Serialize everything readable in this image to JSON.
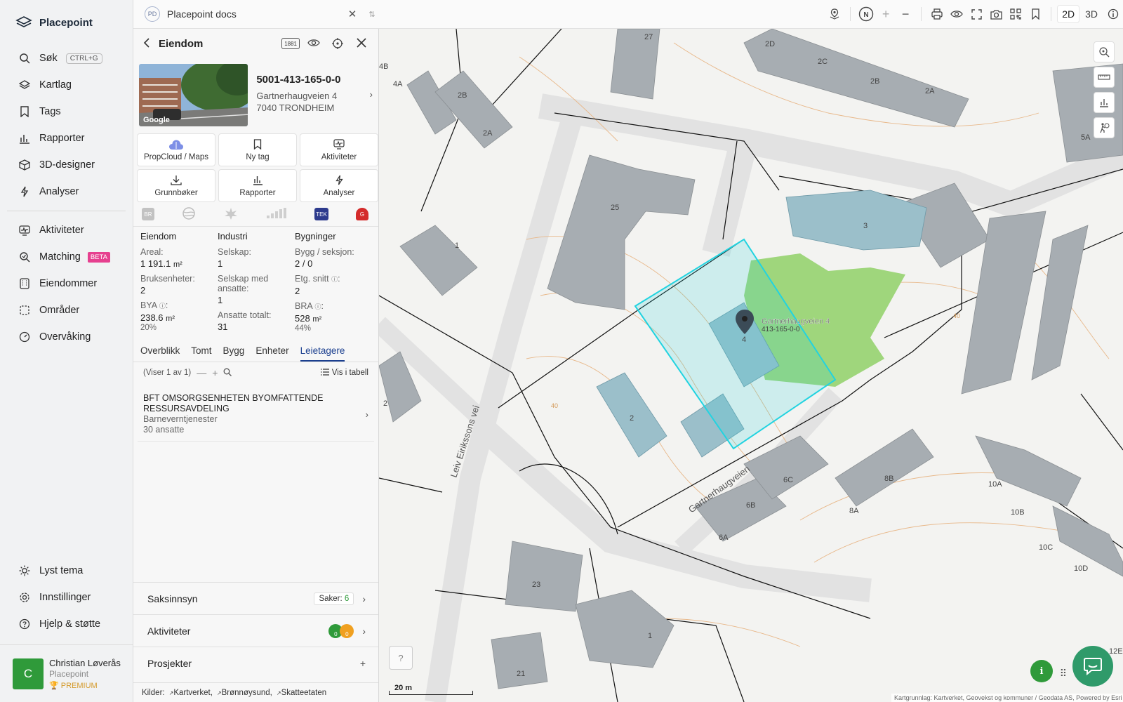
{
  "app": {
    "name": "Placepoint"
  },
  "nav": {
    "items": [
      {
        "label": "Søk",
        "icon": "search-icon",
        "shortcut": "CTRL+G"
      },
      {
        "label": "Kartlag",
        "icon": "layers-icon"
      },
      {
        "label": "Tags",
        "icon": "bookmark-icon"
      },
      {
        "label": "Rapporter",
        "icon": "bar-chart-icon"
      },
      {
        "label": "3D-designer",
        "icon": "cube-icon"
      },
      {
        "label": "Analyser",
        "icon": "bolt-icon"
      }
    ],
    "items2": [
      {
        "label": "Aktiviteter",
        "icon": "activity-icon"
      },
      {
        "label": "Matching",
        "icon": "match-icon",
        "badge": "BETA"
      },
      {
        "label": "Eiendommer",
        "icon": "building-icon"
      },
      {
        "label": "Områder",
        "icon": "area-icon"
      },
      {
        "label": "Overvåking",
        "icon": "monitor-icon"
      }
    ],
    "bottom": [
      {
        "label": "Lyst tema",
        "icon": "sun-icon"
      },
      {
        "label": "Innstillinger",
        "icon": "gear-icon"
      },
      {
        "label": "Hjelp & støtte",
        "icon": "help-icon"
      }
    ],
    "user": {
      "initial": "C",
      "name": "Christian Løverås",
      "org": "Placepoint",
      "plan": "PREMIUM"
    }
  },
  "topbar": {
    "doc_badge": "PD",
    "doc_title": "Placepoint docs",
    "mode_2d": "2D",
    "mode_3d": "3D",
    "north": "N"
  },
  "panel": {
    "title": "Eiendom",
    "badge_1881": "1881",
    "property": {
      "id": "5001-413-165-0-0",
      "address": "Gartnerhaugveien 4",
      "postal": "7040 TRONDHEIM",
      "thumb_label": "Google"
    },
    "actions": [
      {
        "label": "PropCloud / Maps",
        "icon": "cloud-icon"
      },
      {
        "label": "Ny tag",
        "icon": "bookmark-icon"
      },
      {
        "label": "Aktiviteter",
        "icon": "activity-icon"
      },
      {
        "label": "Grunnbøker",
        "icon": "download-icon"
      },
      {
        "label": "Rapporter",
        "icon": "bar-chart-icon"
      },
      {
        "label": "Analyser",
        "icon": "bolt-icon"
      }
    ],
    "logos": {
      "br": "BR",
      "tek": "TEK",
      "g": "G"
    },
    "stats": {
      "eiendom": {
        "header": "Eiendom",
        "areal_label": "Areal:",
        "areal_value": "1 191.1",
        "areal_unit": "m²",
        "bruk_label": "Bruksenheter:",
        "bruk_value": "2",
        "bya_label": "BYA",
        "bya_value": "238.6",
        "bya_unit": "m²",
        "bya_pct": "20%"
      },
      "industri": {
        "header": "Industri",
        "selskap_label": "Selskap:",
        "selskap_value": "1",
        "ansatte_label": "Selskap med ansatte:",
        "ansatte_value": "1",
        "total_label": "Ansatte totalt:",
        "total_value": "31"
      },
      "bygninger": {
        "header": "Bygninger",
        "bygg_label": "Bygg / seksjon:",
        "bygg_value": "2 / 0",
        "etg_label": "Etg. snitt",
        "etg_value": "2",
        "bra_label": "BRA",
        "bra_value": "528",
        "bra_unit": "m²",
        "bra_pct": "44%"
      }
    },
    "tabs": [
      "Overblikk",
      "Tomt",
      "Bygg",
      "Enheter",
      "Leietagere"
    ],
    "active_tab": "Leietagere",
    "list": {
      "count": "(Viser 1 av 1)",
      "table_label": "Vis i tabell"
    },
    "tenant": {
      "name": "BFT OMSORGSENHETEN BYOMFATTENDE RESSURSAVDELING",
      "industry": "Barneverntjenester",
      "employees": "30 ansatte"
    },
    "sections": {
      "saksinnsyn": "Saksinnsyn",
      "saker_label": "Saker:",
      "saker_count": "6",
      "aktiviteter": "Aktiviteter",
      "akt_badge_1": "0",
      "akt_badge_2": "0",
      "prosjekter": "Prosjekter"
    },
    "sources": {
      "label": "Kilder:",
      "items": [
        "Kartverket,",
        "Brønnøysund,",
        "Skatteetaten"
      ]
    }
  },
  "map": {
    "selected_label": "Gartnerhaugveien 4",
    "selected_id": "413-165-0-0",
    "road_1": "Leiv Eirikssons vei",
    "road_2": "Gartnerhaugveien",
    "contour_label": "40",
    "contour_label_2": "40",
    "building_numbers": [
      "27",
      "2D",
      "2C",
      "2B",
      "2A",
      "4B",
      "4A",
      "2B",
      "2A",
      "25",
      "3",
      "1",
      "4",
      "2",
      "6C",
      "6B",
      "6A",
      "8B",
      "8A",
      "10A",
      "10B",
      "10C",
      "10D",
      "23",
      "1",
      "21",
      "2",
      "5A",
      "12E"
    ],
    "scale_label": "20 m",
    "attribution": "Kartgrunnlag: Kartverket, Geovekst og kommuner / Geodata AS, Powered by Esri",
    "colors": {
      "selection": "#22d3e0",
      "building": "#a3aab0",
      "building_blue": "#9bbfca",
      "park": "#9fd67c",
      "contour": "#e8b88a"
    }
  }
}
